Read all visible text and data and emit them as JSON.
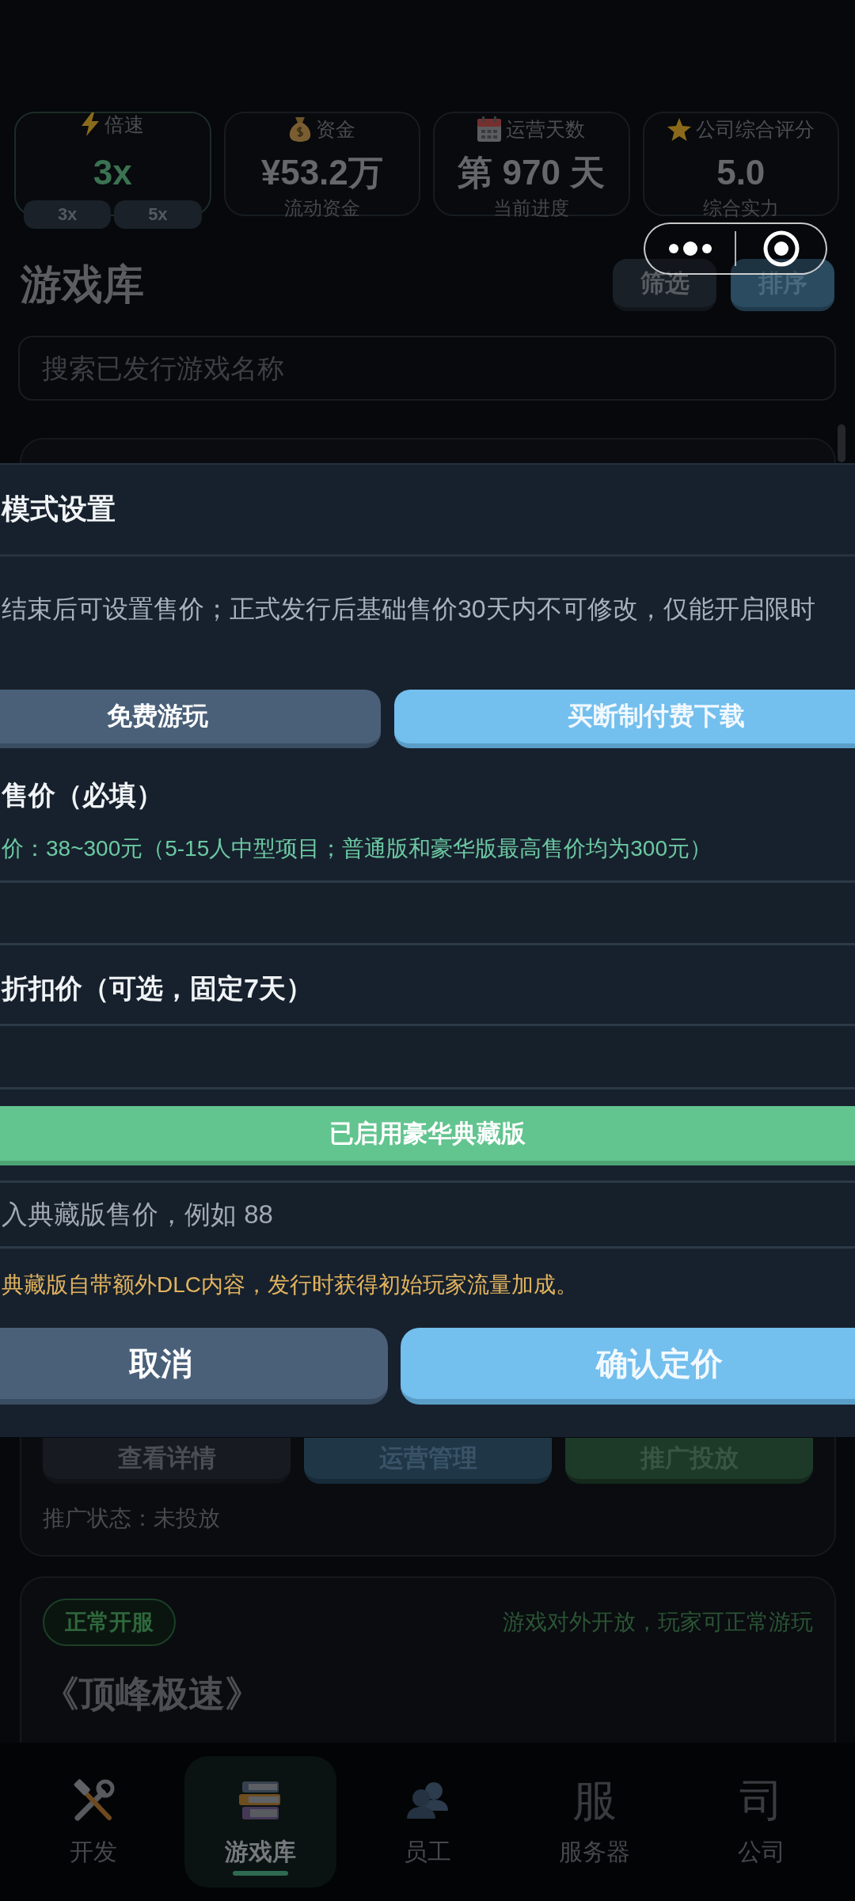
{
  "stats": [
    {
      "kind": "speed",
      "label": "倍速",
      "value": "3x",
      "options": [
        {
          "label": "3x"
        },
        {
          "label": "5x"
        }
      ]
    },
    {
      "kind": "stat",
      "label": "资金",
      "value": "¥53.2万",
      "caption": "流动资金"
    },
    {
      "kind": "stat",
      "label": "运营天数",
      "value": "第 970 天",
      "caption": "当前进度"
    },
    {
      "kind": "stat",
      "label": "公司综合评分",
      "value": "5.0",
      "caption": "综合实力"
    }
  ],
  "library": {
    "title": "游戏库",
    "buttons": [
      {
        "label": "筛选",
        "kind": "plain"
      },
      {
        "label": "排序",
        "kind": "accent"
      }
    ],
    "search": {
      "placeholder": "搜索已发行游戏名称"
    }
  },
  "games": [
    {
      "actions": [
        {
          "label": "查看详情",
          "kind": "plain"
        },
        {
          "label": "运营管理",
          "kind": "info"
        },
        {
          "label": "推广投放",
          "kind": "success"
        }
      ],
      "promotion": "推广状态：未投放"
    },
    {
      "badge": "正常开服",
      "status_note": "游戏对外开放，玩家可正常游玩",
      "title": "《顶峰极速》"
    }
  ],
  "modal": {
    "title": "模式设置",
    "description": "结束后可设置售价；正式发行后基础售价30天内不可修改，仅能开启限时",
    "modes": [
      {
        "label": "免费游玩",
        "selected": false
      },
      {
        "label": "买断制付费下载",
        "selected": true
      }
    ],
    "price": {
      "label": "售价（必填）",
      "hint": "价：38~300元（5-15人中型项目；普通版和豪华版最高售价均为300元）"
    },
    "discount": {
      "label": "折扣价（可选，固定7天）"
    },
    "deluxe": {
      "label": "已启用豪华典藏版",
      "on": true,
      "placeholder": "入典藏版售价，例如 88",
      "note": "典藏版自带额外DLC内容，发行时获得初始玩家流量加成。"
    },
    "actions": [
      {
        "label": "取消",
        "kind": "secondary"
      },
      {
        "label": "确认定价",
        "kind": "primary"
      }
    ]
  },
  "nav": [
    {
      "label": "开发",
      "selected": false
    },
    {
      "label": "游戏库",
      "selected": true
    },
    {
      "label": "员工",
      "selected": false
    },
    {
      "label": "服务器",
      "glyph": "服",
      "selected": false
    },
    {
      "label": "公司",
      "glyph": "司",
      "selected": false
    }
  ]
}
